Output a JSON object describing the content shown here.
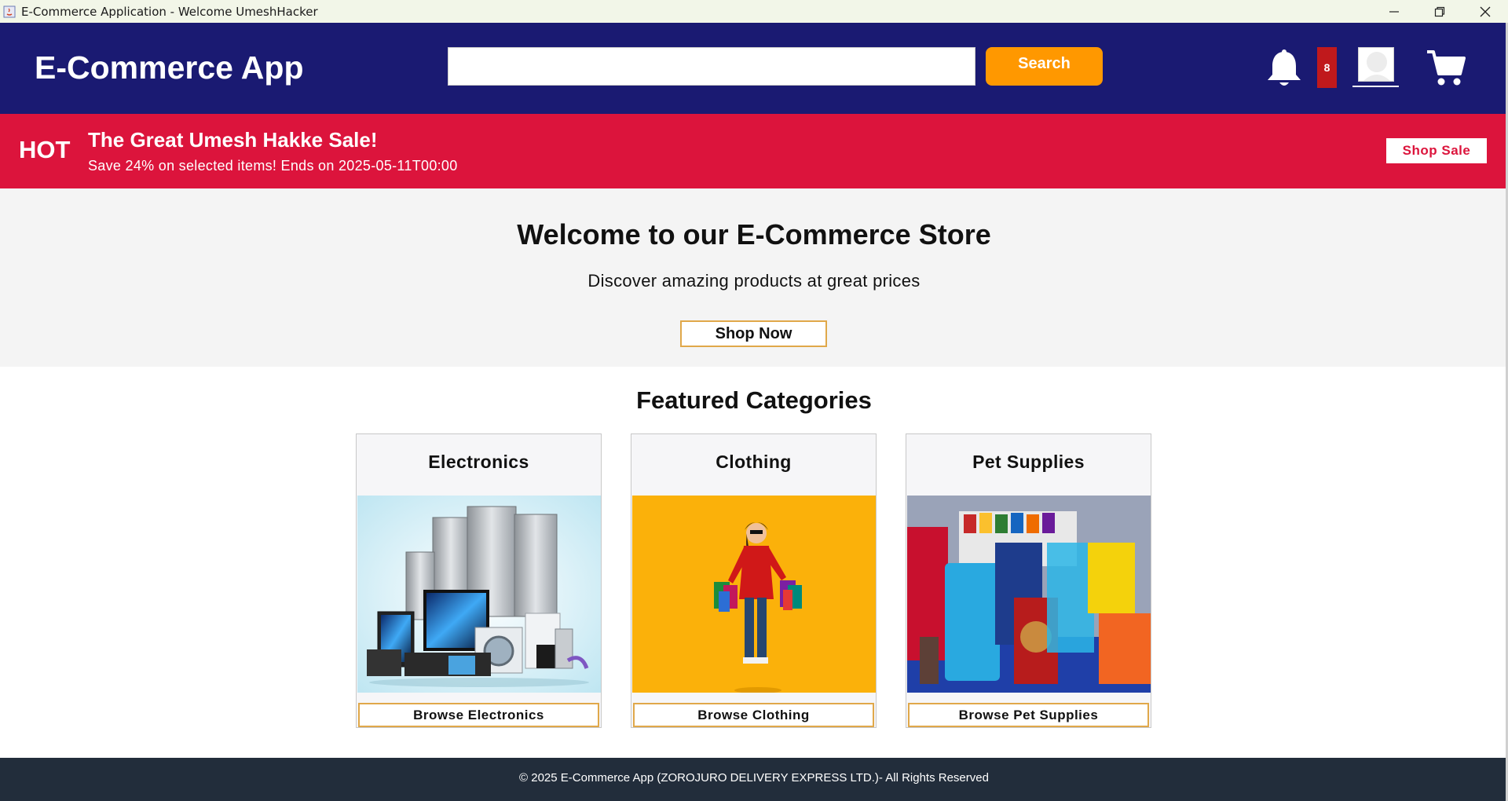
{
  "window": {
    "title": "E-Commerce Application - Welcome UmeshHacker",
    "icon": "java-icon",
    "controls": [
      "minimize-icon",
      "restore-icon",
      "close-icon"
    ]
  },
  "header": {
    "brand": "E-Commerce App",
    "search": {
      "value": "",
      "placeholder": ""
    },
    "search_button": "Search",
    "notification_count": "8",
    "icons": [
      "bell-icon",
      "profile-icon",
      "cart-icon"
    ],
    "colors": {
      "background": "#1a1a72",
      "search_button": "#ff9800",
      "badge": "#c0191c"
    }
  },
  "banner": {
    "tag": "HOT",
    "title": "The Great Umesh Hakke Sale!",
    "description": "Save 24% on selected items! Ends on 2025-05-11T00:00",
    "button": "Shop Sale",
    "color": "#dc143c"
  },
  "hero": {
    "title": "Welcome to our E-Commerce Store",
    "subtitle": "Discover amazing products at great prices",
    "button": "Shop Now"
  },
  "featured": {
    "title": "Featured Categories",
    "categories": [
      {
        "name": "Electronics",
        "button": "Browse Electronics",
        "image": "electronics-image"
      },
      {
        "name": "Clothing",
        "button": "Browse Clothing",
        "image": "clothing-image"
      },
      {
        "name": "Pet Supplies",
        "button": "Browse Pet Supplies",
        "image": "pet-supplies-image"
      }
    ]
  },
  "footer": {
    "text": "© 2025 E-Commerce App (ZOROJURO DELIVERY EXPRESS LTD.)- All Rights Reserved"
  }
}
